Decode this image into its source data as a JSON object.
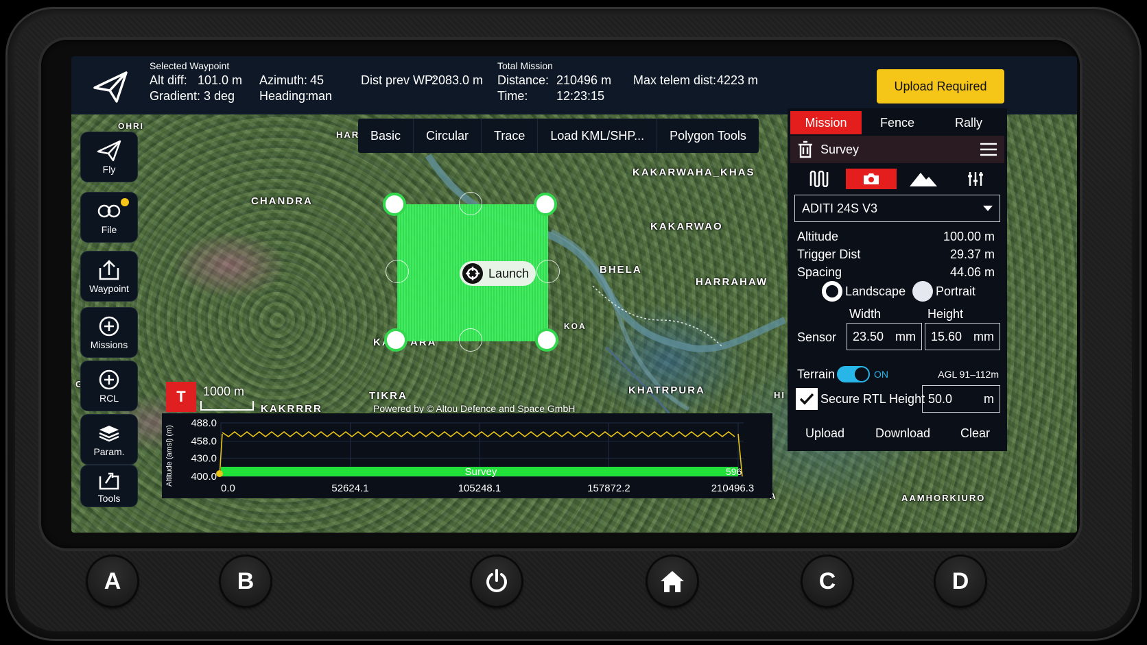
{
  "topbar": {
    "selected_waypoint": "Selected Waypoint",
    "alt_diff_label": "Alt diff:",
    "alt_diff": "101.0 m",
    "gradient_label": "Gradient:",
    "gradient": "3 deg",
    "azimuth_label": "Azimuth:",
    "azimuth": "45",
    "heading_label": "Heading:",
    "heading": "man",
    "dist_prev_label": "Dist prev WP:",
    "dist_prev": "2083.0 m",
    "total_mission": "Total Mission",
    "distance_label": "Distance:",
    "distance": "210496 m",
    "time_label": "Time:",
    "time": "12:23:15",
    "max_telem_label": "Max telem dist:",
    "max_telem": "4223 m",
    "upload_required": "Upload Required",
    "upload_color": "#f5c518"
  },
  "nav": [
    {
      "label": "Fly",
      "icon": "paper-plane-icon"
    },
    {
      "label": "File",
      "icon": "file-icon"
    },
    {
      "label": "Waypoint",
      "icon": "upload-box-icon"
    },
    {
      "label": "Missions",
      "icon": "plus-circle-icon"
    },
    {
      "label": "RCL",
      "icon": "plus-circle-icon"
    },
    {
      "label": "Param.",
      "icon": "layers-icon"
    },
    {
      "label": "Tools",
      "icon": "tools-icon"
    }
  ],
  "toolbar": [
    "Basic",
    "Circular",
    "Trace",
    "Load KML/SHP...",
    "Polygon Tools"
  ],
  "map": {
    "places": [
      "CHANDRA",
      "KAKARWAHA_KHAS",
      "KAKARWAO",
      "BHELA",
      "HARRAHAW",
      "KHATRPURA",
      "TIKRA",
      "KAKRRRR",
      "AAMHORKIURO",
      "OHRI",
      "HAR",
      "KA",
      "ARA",
      "KOA",
      "GRI",
      "HI",
      "A"
    ],
    "launch_label": "Launch",
    "t_marker": "T",
    "scale": "1000 m",
    "powered_by": "Powered by © Altou Defence and Space GmbH"
  },
  "chart_data": {
    "type": "area",
    "ylabel": "Altitude (amsl) (m)",
    "yticks": [
      "488.0",
      "458.0",
      "430.0",
      "400.0"
    ],
    "xticks": [
      "0.0",
      "52624.1",
      "105248.1",
      "157872.2",
      "210496.3"
    ],
    "ylim": [
      400,
      488
    ],
    "xlim": [
      0,
      210496.3
    ],
    "series": [
      {
        "name": "Survey",
        "end_label": "596"
      }
    ]
  },
  "panel": {
    "tabs": [
      "Mission",
      "Fence",
      "Rally"
    ],
    "active_tab": "Mission",
    "accent": "#e41d1d",
    "survey_title": "Survey",
    "icon_tabs": [
      "pattern-icon",
      "camera-icon",
      "terrain-icon",
      "sliders-icon"
    ],
    "camera": "ADITI 24S V3",
    "altitude_label": "Altitude",
    "altitude": "100.00 m",
    "trigger_label": "Trigger Dist",
    "trigger": "29.37 m",
    "spacing_label": "Spacing",
    "spacing": "44.06 m",
    "landscape": "Landscape",
    "portrait": "Portrait",
    "width_label": "Width",
    "height_label": "Height",
    "sensor_label": "Sensor",
    "sensor_width": "23.50",
    "sensor_height": "15.60",
    "unit_mm": "mm",
    "terrain_label": "Terrain",
    "terrain_state": "ON",
    "agl": "AGL 91–112m",
    "secure_rtl_label": "Secure RTL Height",
    "secure_rtl": "50.0",
    "unit_m": "m",
    "upload": "Upload",
    "download": "Download",
    "clear": "Clear"
  },
  "hardware": [
    "A",
    "B",
    "C",
    "D"
  ]
}
